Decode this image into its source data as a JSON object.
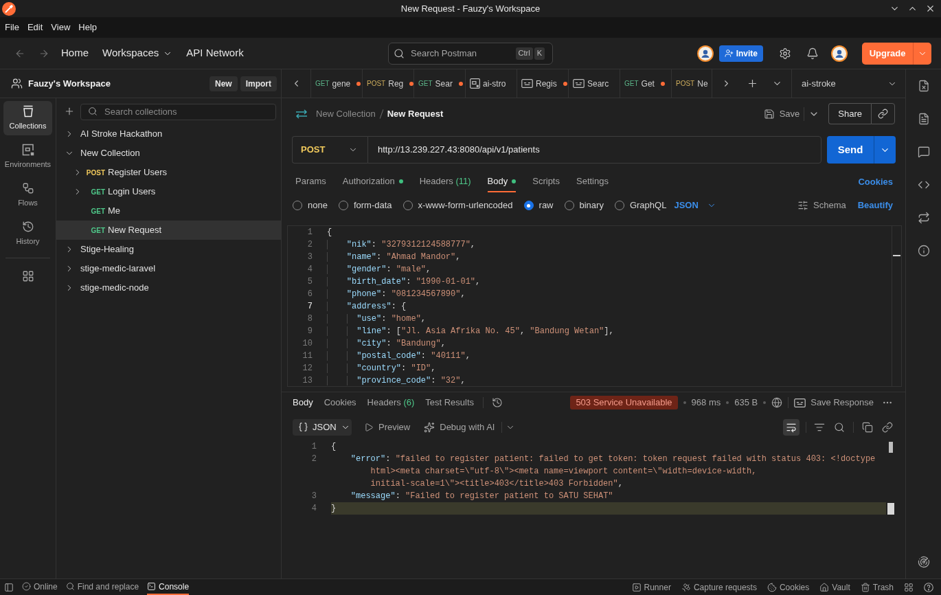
{
  "window": {
    "title": "New Request - Fauzy's Workspace"
  },
  "menu": [
    "File",
    "Edit",
    "View",
    "Help"
  ],
  "header": {
    "nav": [
      {
        "label": "Home",
        "kind": "link"
      },
      {
        "label": "Workspaces",
        "kind": "dropdown"
      },
      {
        "label": "API Network",
        "kind": "link"
      }
    ],
    "search": {
      "placeholder": "Search Postman",
      "shortcut": [
        "Ctrl",
        "K"
      ]
    },
    "invite": "Invite",
    "upgrade": "Upgrade"
  },
  "sidebar": {
    "workspace": "Fauzy's Workspace",
    "actions": [
      "New",
      "Import"
    ],
    "rail": [
      {
        "label": "Collections",
        "kind": "collections",
        "selected": true
      },
      {
        "label": "Environments",
        "kind": "environments",
        "selected": false
      },
      {
        "label": "Flows",
        "kind": "flows",
        "selected": false
      },
      {
        "label": "History",
        "kind": "history",
        "selected": false
      }
    ],
    "search": {
      "placeholder": "Search collections"
    },
    "tree": [
      {
        "kind": "collection",
        "label": "AI Stroke Hackathon",
        "expanded": false,
        "selected": false
      },
      {
        "kind": "collection",
        "label": "New Collection",
        "expanded": true,
        "selected": false,
        "children": [
          {
            "kind": "request",
            "method": "POST",
            "color": "#f0c95c",
            "label": "Register Users",
            "expanded": false,
            "selected": false
          },
          {
            "kind": "request",
            "method": "GET",
            "color": "#4fc98a",
            "label": "Login Users",
            "expanded": false,
            "selected": false
          },
          {
            "kind": "request",
            "method": "GET",
            "color": "#4fc98a",
            "label": "Me",
            "selected": false
          },
          {
            "kind": "request",
            "method": "GET",
            "color": "#4fc98a",
            "label": "New Request",
            "selected": true
          }
        ]
      },
      {
        "kind": "collection",
        "label": "Stige-Healing",
        "expanded": false,
        "selected": false
      },
      {
        "kind": "collection",
        "label": "stige-medic-laravel",
        "expanded": false,
        "selected": false
      },
      {
        "kind": "collection",
        "label": "stige-medic-node",
        "expanded": false,
        "selected": false
      }
    ]
  },
  "tabs": [
    {
      "kind": "request",
      "method": "GET",
      "color": "#5bb488",
      "label": "gene",
      "unsaved": true
    },
    {
      "kind": "request",
      "method": "POST",
      "color": "#cfae5c",
      "label": "Reg",
      "unsaved": true
    },
    {
      "kind": "request",
      "method": "GET",
      "color": "#5bb488",
      "label": "Sear",
      "unsaved": true
    },
    {
      "kind": "collection",
      "label": "ai-stro",
      "unsaved": false
    },
    {
      "kind": "example",
      "label": "Regis",
      "unsaved": true
    },
    {
      "kind": "example",
      "label": "Searc",
      "unsaved": false
    },
    {
      "kind": "request",
      "method": "GET",
      "color": "#5bb488",
      "label": "Get",
      "unsaved": true
    },
    {
      "kind": "request",
      "method": "POST",
      "color": "#cfae5c",
      "label": "Ne",
      "unsaved": false
    }
  ],
  "environment": "ai-stroke",
  "request": {
    "breadcrumb": {
      "parent": "New Collection",
      "name": "New Request"
    },
    "save": "Save",
    "share": "Share",
    "method": "POST",
    "url": "http://13.239.227.43:8080/api/v1/patients",
    "send": "Send",
    "tabs": [
      {
        "label": "Params",
        "dot": false,
        "selected": false
      },
      {
        "label": "Authorization",
        "dot": true,
        "selected": false
      },
      {
        "label": "Headers",
        "count": "(11)",
        "dot": false,
        "selected": false
      },
      {
        "label": "Body",
        "dot": true,
        "selected": true
      },
      {
        "label": "Scripts",
        "dot": false,
        "selected": false
      },
      {
        "label": "Settings",
        "dot": false,
        "selected": false
      }
    ],
    "cookies": "Cookies",
    "body_types": [
      {
        "label": "none",
        "selected": false
      },
      {
        "label": "form-data",
        "selected": false
      },
      {
        "label": "x-www-form-urlencoded",
        "selected": false
      },
      {
        "label": "raw",
        "selected": true
      },
      {
        "label": "binary",
        "selected": false
      },
      {
        "label": "GraphQL",
        "selected": false
      }
    ],
    "format": "JSON",
    "schema": "Schema",
    "beautify": "Beautify",
    "lines": [
      {
        "number": "1",
        "active": false,
        "tokens": [
          {
            "kind": "punct",
            "text": "{"
          }
        ]
      },
      {
        "number": "2",
        "active": false,
        "tokens": [
          {
            "kind": "key",
            "text": "    \"nik\""
          },
          {
            "kind": "punct",
            "text": ": "
          },
          {
            "kind": "string",
            "text": "\"3279312124588777\""
          },
          {
            "kind": "punct",
            "text": ","
          }
        ]
      },
      {
        "number": "3",
        "active": false,
        "tokens": [
          {
            "kind": "key",
            "text": "    \"name\""
          },
          {
            "kind": "punct",
            "text": ": "
          },
          {
            "kind": "string",
            "text": "\"Ahmad Mandor\""
          },
          {
            "kind": "punct",
            "text": ","
          }
        ]
      },
      {
        "number": "4",
        "active": false,
        "tokens": [
          {
            "kind": "key",
            "text": "    \"gender\""
          },
          {
            "kind": "punct",
            "text": ": "
          },
          {
            "kind": "string",
            "text": "\"male\""
          },
          {
            "kind": "punct",
            "text": ","
          }
        ]
      },
      {
        "number": "5",
        "active": false,
        "tokens": [
          {
            "kind": "key",
            "text": "    \"birth_date\""
          },
          {
            "kind": "punct",
            "text": ": "
          },
          {
            "kind": "string",
            "text": "\"1990-01-01\""
          },
          {
            "kind": "punct",
            "text": ","
          }
        ]
      },
      {
        "number": "6",
        "active": false,
        "tokens": [
          {
            "kind": "key",
            "text": "    \"phone\""
          },
          {
            "kind": "punct",
            "text": ": "
          },
          {
            "kind": "string",
            "text": "\"081234567890\""
          },
          {
            "kind": "punct",
            "text": ","
          }
        ]
      },
      {
        "number": "7",
        "active": true,
        "tokens": [
          {
            "kind": "key",
            "text": "    \"address\""
          },
          {
            "kind": "punct",
            "text": ": {"
          }
        ]
      },
      {
        "number": "8",
        "active": false,
        "tokens": [
          {
            "kind": "key",
            "text": "      \"use\""
          },
          {
            "kind": "punct",
            "text": ": "
          },
          {
            "kind": "string",
            "text": "\"home\""
          },
          {
            "kind": "punct",
            "text": ","
          }
        ]
      },
      {
        "number": "9",
        "active": false,
        "tokens": [
          {
            "kind": "key",
            "text": "      \"line\""
          },
          {
            "kind": "punct",
            "text": ": ["
          },
          {
            "kind": "string",
            "text": "\"Jl. Asia Afrika No. 45\""
          },
          {
            "kind": "punct",
            "text": ", "
          },
          {
            "kind": "string",
            "text": "\"Bandung Wetan\""
          },
          {
            "kind": "punct",
            "text": "],"
          }
        ]
      },
      {
        "number": "10",
        "active": false,
        "tokens": [
          {
            "kind": "key",
            "text": "      \"city\""
          },
          {
            "kind": "punct",
            "text": ": "
          },
          {
            "kind": "string",
            "text": "\"Bandung\""
          },
          {
            "kind": "punct",
            "text": ","
          }
        ]
      },
      {
        "number": "11",
        "active": false,
        "tokens": [
          {
            "kind": "key",
            "text": "      \"postal_code\""
          },
          {
            "kind": "punct",
            "text": ": "
          },
          {
            "kind": "string",
            "text": "\"40111\""
          },
          {
            "kind": "punct",
            "text": ","
          }
        ]
      },
      {
        "number": "12",
        "active": false,
        "tokens": [
          {
            "kind": "key",
            "text": "      \"country\""
          },
          {
            "kind": "punct",
            "text": ": "
          },
          {
            "kind": "string",
            "text": "\"ID\""
          },
          {
            "kind": "punct",
            "text": ","
          }
        ]
      },
      {
        "number": "13",
        "active": false,
        "tokens": [
          {
            "kind": "key",
            "text": "      \"province_code\""
          },
          {
            "kind": "punct",
            "text": ": "
          },
          {
            "kind": "string",
            "text": "\"32\""
          },
          {
            "kind": "punct",
            "text": ","
          }
        ]
      }
    ]
  },
  "response": {
    "tabs": [
      {
        "label": "Body",
        "selected": true
      },
      {
        "label": "Cookies",
        "selected": false
      },
      {
        "label": "Headers",
        "count": "(6)",
        "selected": false
      },
      {
        "label": "Test Results",
        "selected": false
      }
    ],
    "status": "503 Service Unavailable",
    "time": "968 ms",
    "size": "635 B",
    "save": "Save Response",
    "view": "JSON",
    "preview": "Preview",
    "debug": "Debug with AI",
    "wrap_lines": true,
    "lines": [
      {
        "number": "1",
        "highlighted": false,
        "tokens": [
          {
            "kind": "punct",
            "text": "{"
          }
        ]
      },
      {
        "number": "2",
        "highlighted": false,
        "tokens": [
          {
            "kind": "key",
            "text": "    \"error\""
          },
          {
            "kind": "punct",
            "text": ": "
          },
          {
            "kind": "string",
            "text": "\"failed to register patient: failed to get token: token request failed with status 403: <!doctype html><meta charset=\\\"utf-8\\\"><meta name=viewport content=\\\"width=device-width, initial-scale=1\\\"><title>403</title>403 Forbidden\""
          },
          {
            "kind": "punct",
            "text": ","
          }
        ]
      },
      {
        "number": "3",
        "highlighted": false,
        "tokens": [
          {
            "kind": "key",
            "text": "    \"message\""
          },
          {
            "kind": "punct",
            "text": ": "
          },
          {
            "kind": "string",
            "text": "\"Failed to register patient to SATU SEHAT\""
          }
        ]
      },
      {
        "number": "4",
        "highlighted": true,
        "tokens": [
          {
            "kind": "punct",
            "text": "}"
          }
        ]
      }
    ]
  },
  "status_bar": {
    "left": [
      {
        "kind": "online",
        "label": "Online",
        "selected": false
      },
      {
        "kind": "find",
        "label": "Find and replace",
        "selected": false
      },
      {
        "kind": "console",
        "label": "Console",
        "selected": true
      }
    ],
    "right": [
      {
        "kind": "runner",
        "label": "Runner"
      },
      {
        "kind": "capture",
        "label": "Capture requests"
      },
      {
        "kind": "cookies",
        "label": "Cookies"
      },
      {
        "kind": "vault",
        "label": "Vault"
      },
      {
        "kind": "trash",
        "label": "Trash"
      }
    ]
  }
}
